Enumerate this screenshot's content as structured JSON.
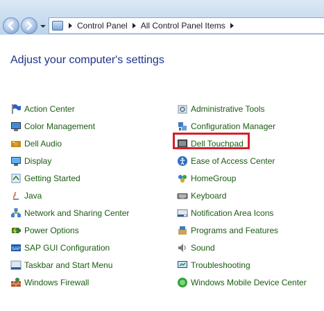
{
  "breadcrumb": [
    "Control Panel",
    "All Control Panel Items"
  ],
  "page_title": "Adjust your computer's settings",
  "left_items": [
    {
      "label": "Action Center",
      "icon": "flag-icon"
    },
    {
      "label": "Color Management",
      "icon": "color-management-icon"
    },
    {
      "label": "Dell Audio",
      "icon": "dell-audio-icon"
    },
    {
      "label": "Display",
      "icon": "display-icon"
    },
    {
      "label": "Getting Started",
      "icon": "getting-started-icon"
    },
    {
      "label": "Java",
      "icon": "java-icon"
    },
    {
      "label": "Network and Sharing Center",
      "icon": "network-icon"
    },
    {
      "label": "Power Options",
      "icon": "power-icon"
    },
    {
      "label": "SAP GUI Configuration",
      "icon": "sap-icon"
    },
    {
      "label": "Taskbar and Start Menu",
      "icon": "taskbar-icon"
    },
    {
      "label": "Windows Firewall",
      "icon": "firewall-icon"
    }
  ],
  "right_items": [
    {
      "label": "Administrative Tools",
      "icon": "admin-tools-icon"
    },
    {
      "label": "Configuration Manager",
      "icon": "config-manager-icon"
    },
    {
      "label": "Dell Touchpad",
      "icon": "touchpad-icon"
    },
    {
      "label": "Ease of Access Center",
      "icon": "ease-of-access-icon"
    },
    {
      "label": "HomeGroup",
      "icon": "homegroup-icon"
    },
    {
      "label": "Keyboard",
      "icon": "keyboard-icon"
    },
    {
      "label": "Notification Area Icons",
      "icon": "notification-icon"
    },
    {
      "label": "Programs and Features",
      "icon": "programs-icon"
    },
    {
      "label": "Sound",
      "icon": "speaker-icon"
    },
    {
      "label": "Troubleshooting",
      "icon": "troubleshooting-icon"
    },
    {
      "label": "Windows Mobile Device Center",
      "icon": "mobile-device-icon"
    }
  ],
  "highlighted_item": "Dell Touchpad",
  "colors": {
    "link": "#1a5c11",
    "title": "#1e3287",
    "highlight": "#d61f2b"
  }
}
